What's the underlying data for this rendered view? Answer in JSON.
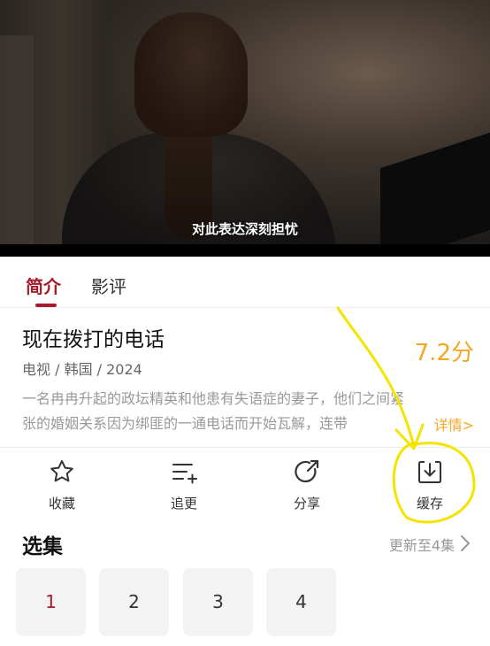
{
  "video": {
    "subtitle": "对此表达深刻担忧"
  },
  "tabs": [
    {
      "label": "简介",
      "active": true
    },
    {
      "label": "影评",
      "active": false
    }
  ],
  "info": {
    "title": "现在拨打的电话",
    "score": "7.2分",
    "meta": "电视 / 韩国 / 2024",
    "description_line1": "一名冉冉升起的政坛精英和他患有失语症的妻子，他们之间紧",
    "description_line2": "张的婚姻关系因为绑匪的一通电话而开始瓦解，连带",
    "detail_link": "详情>"
  },
  "actions": [
    {
      "label": "收藏",
      "icon": "star-icon"
    },
    {
      "label": "追更",
      "icon": "follow-list-icon"
    },
    {
      "label": "分享",
      "icon": "share-icon"
    },
    {
      "label": "缓存",
      "icon": "download-icon"
    }
  ],
  "episodes": {
    "title": "选集",
    "update_text": "更新至4集",
    "items": [
      "1",
      "2",
      "3",
      "4"
    ],
    "selected": "1"
  },
  "colors": {
    "accent": "#a51d2d",
    "score": "#f5a623",
    "annotation": "#f5e400"
  }
}
